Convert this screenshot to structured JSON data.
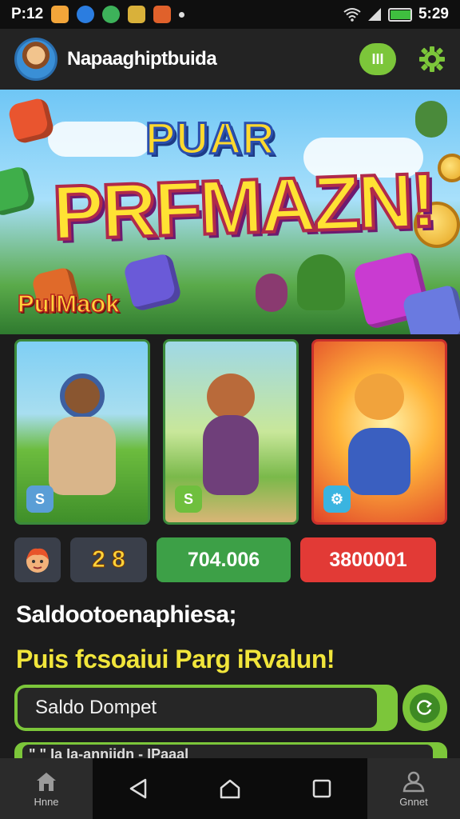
{
  "status_bar": {
    "time": "P:12",
    "clock": "5:29",
    "battery_percent": 95
  },
  "app_bar": {
    "title": "Napaaghiptbuida",
    "menu_label": "III"
  },
  "banner": {
    "title_top": "PUAR",
    "title_main": "PRFMAZN!",
    "subtitle": "PulMaok"
  },
  "cards": [
    {
      "badge": "S",
      "name": "card-explorer"
    },
    {
      "badge": "S",
      "name": "card-fox-warrior"
    },
    {
      "badge": "⚙",
      "name": "card-fox-runner"
    }
  ],
  "stats": {
    "score": "2 8",
    "green_value": "704.006",
    "red_value": "3800001"
  },
  "section": {
    "heading": "Saldootoenaphiesa;",
    "subheading": "Puis fcsoaiui Parg iRvalun!"
  },
  "wallet": {
    "placeholder": "Saldo Dompet",
    "peek_text": "\" \" Ia Ia-anniidn - IPaaal"
  },
  "nav": {
    "home_label": "Hnne",
    "account_label": "Gnnet"
  },
  "colors": {
    "accent_green": "#7cc63a",
    "stat_green": "#3da047",
    "stat_red": "#e23a36",
    "title_yellow": "#ffe233"
  }
}
